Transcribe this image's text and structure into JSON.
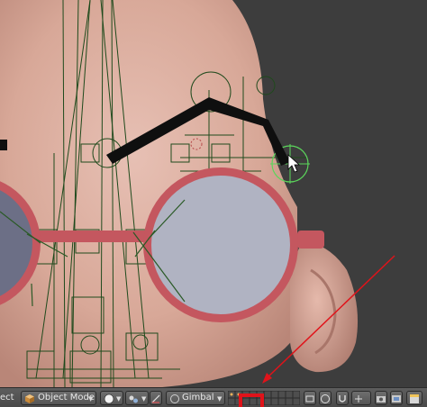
{
  "viewport": {
    "name": "3D Viewport",
    "background": "#3d3d3d"
  },
  "header": {
    "left_clip_text": "ect",
    "mode_label": "Object Mode",
    "orientation_label": "Gimbal",
    "icons": [
      "object-mode-cube-icon",
      "viewport-shading-sphere-icon",
      "pivot-point-icon",
      "manipulator-icon",
      "layer-grid-icon",
      "snap-magnet-icon",
      "proportional-edit-icon",
      "render-camera-icon",
      "render-animation-icon"
    ]
  },
  "annotation": {
    "color": "#e0131a"
  }
}
